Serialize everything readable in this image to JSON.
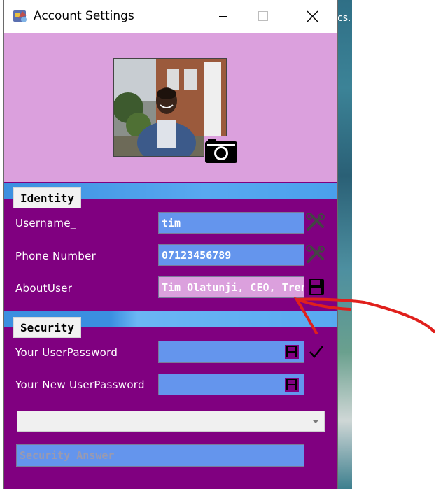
{
  "window": {
    "title": "Account Settings",
    "background_color": "#800080",
    "header_color": "#dba0dd"
  },
  "desktop": {
    "ghost_text": "cs..."
  },
  "profile": {
    "photo_alt": "profile-photo",
    "camera_icon": "camera-icon"
  },
  "identity": {
    "section_label": "Identity",
    "username_label": "Username_",
    "username_value": "tim",
    "phone_label": "Phone Number",
    "phone_value": "07123456789",
    "about_label": "AboutUser",
    "about_value": "Tim Olatunji, CEO, Trents Ac",
    "edit_icon": "tools-icon",
    "save_icon": "save-icon"
  },
  "security": {
    "section_label": "Security",
    "password_label": "Your UserPassword",
    "password_value": "",
    "new_password_label": "Your New UserPassword",
    "new_password_value": "",
    "question_selected": "",
    "answer_placeholder": "Security Answer",
    "check_icon": "check-icon"
  },
  "colors": {
    "input_blue": "#6495ed",
    "band_blue": "#3b8fe0",
    "annotation_red": "#e0201c"
  }
}
